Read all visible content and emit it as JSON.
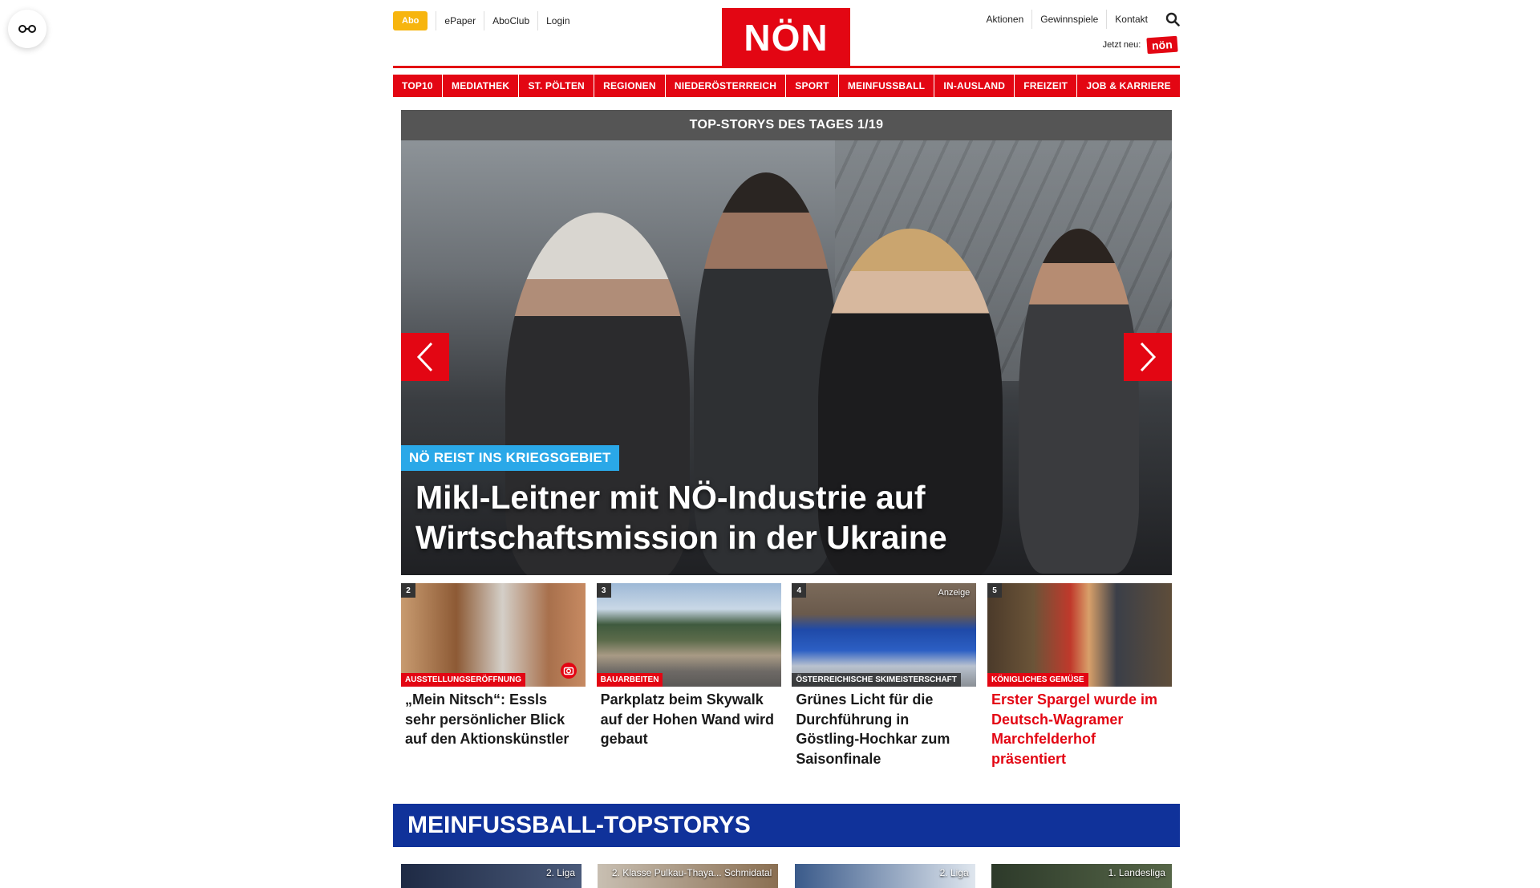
{
  "header": {
    "abo_label": "Abo",
    "util_links": [
      "ePaper",
      "AboClub",
      "Login"
    ],
    "logo": "NÖN",
    "right_links": [
      "Aktionen",
      "Gewinnspiele",
      "Kontakt"
    ],
    "jetzt_text": "Jetzt neu:",
    "jetzt_badge": "nön"
  },
  "nav": [
    "TOP10",
    "MEDIATHEK",
    "ST. PÖLTEN",
    "REGIONEN",
    "NIEDERÖSTERREICH",
    "SPORT",
    "MEINFUSSBALL",
    "IN-AUSLAND",
    "FREIZEIT",
    "JOB & KARRIERE"
  ],
  "hero": {
    "bar_title": "TOP-STORYS DES TAGES 1/19",
    "badge": "NÖ REIST INS KRIEGSGEBIET",
    "title": "Mikl-Leitner mit NÖ-Industrie auf Wirtschaftsmission in der Ukraine"
  },
  "cards": [
    {
      "num": "2",
      "category": "AUSSTELLUNGSERÖFFNUNG",
      "title": "„Mein Nitsch“: Essls sehr persönlicher Blick auf den Aktionskünstler"
    },
    {
      "num": "3",
      "category": "BAUARBEITEN",
      "title": "Parkplatz beim Skywalk auf der Hohen Wand wird gebaut"
    },
    {
      "num": "4",
      "category": "ÖSTERREICHISCHE SKIMEISTERSCHAFT",
      "anzeige": "Anzeige",
      "title": "Grünes Licht für die Durchführung in Göstling-Hochkar zum Saisonfinale"
    },
    {
      "num": "5",
      "category": "KÖNIGLICHES GEMÜSE",
      "title": "Erster Spargel wurde im Deutsch-Wagramer Marchfelderhof präsentiert"
    }
  ],
  "section": {
    "title": "MEINFUSSBALL-TOPSTORYS",
    "tiles": [
      "2. Liga",
      "2. Klasse Pulkau-Thaya... Schmidatal",
      "2. Liga",
      "1. Landesliga"
    ]
  },
  "colors": {
    "brand_red": "#e30613",
    "abo_yellow": "#f7b50e",
    "hero_badge_blue": "#2aa8e8",
    "section_blue": "#10329a"
  }
}
